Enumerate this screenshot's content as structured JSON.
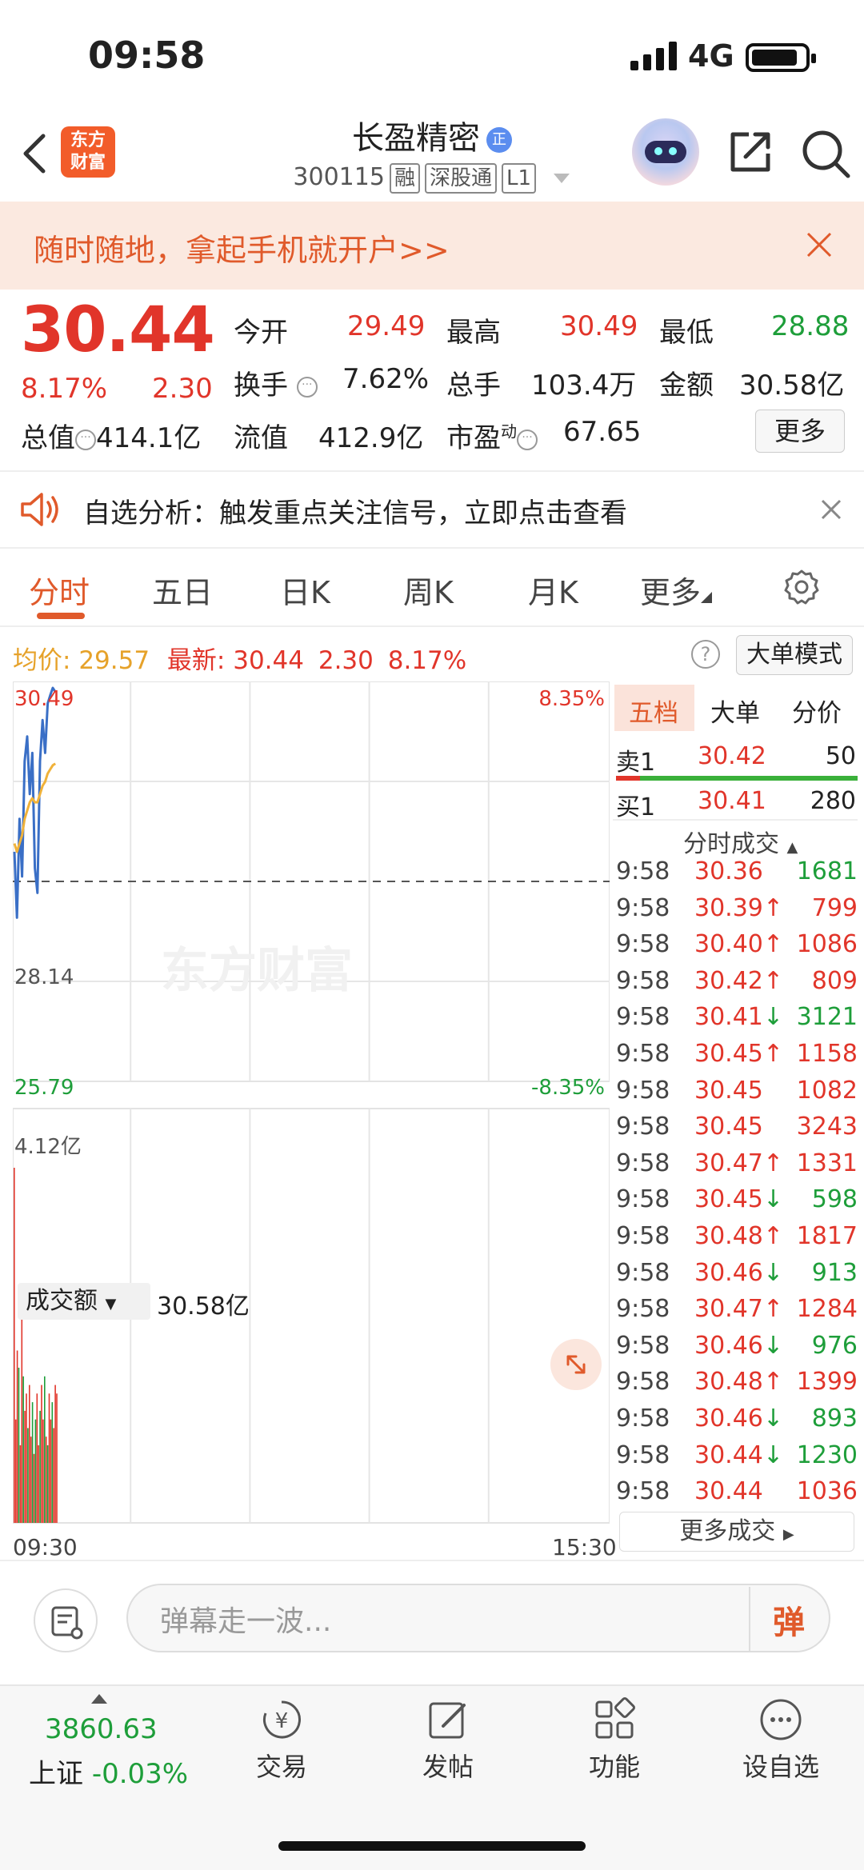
{
  "status": {
    "time": "09:58",
    "network": "4G"
  },
  "header": {
    "title": "长盈精密",
    "title_badge": "正",
    "code": "300115",
    "tags": [
      "融",
      "深股通",
      "L1"
    ],
    "logo": "东方\n财富"
  },
  "banner": {
    "text": "随时随地，拿起手机就开户>>"
  },
  "quote": {
    "price": "30.44",
    "change_pct": "8.17%",
    "change": "2.30",
    "open_label": "今开",
    "open": "29.49",
    "high_label": "最高",
    "high": "30.49",
    "low_label": "最低",
    "low": "28.88",
    "turnover_label": "换手",
    "turnover": "7.62%",
    "volume_label": "总手",
    "volume": "103.4万",
    "amount_label": "金额",
    "amount": "30.58亿",
    "mktcap_label": "总值",
    "mktcap": "414.1亿",
    "float_label": "流值",
    "float": "412.9亿",
    "pe_label": "市盈",
    "pe_sup": "动",
    "pe": "67.65",
    "more": "更多"
  },
  "notice": {
    "text": "自选分析：触发重点关注信号，立即点击查看"
  },
  "tabs": [
    "分时",
    "五日",
    "日K",
    "周K",
    "月K",
    "更多"
  ],
  "infoline": {
    "avg_label": "均价:",
    "avg": "29.57",
    "last_label": "最新:",
    "last": "30.44",
    "chg": "2.30",
    "pct": "8.17%",
    "mode": "大单模式"
  },
  "chart_labels": {
    "top_left": "30.49",
    "top_right": "8.35%",
    "mid_left": "28.14",
    "bottom_left": "25.79",
    "bottom_right": "-8.35%",
    "vol_selector": "成交额",
    "vol_value": "30.58亿",
    "vol_max": "4.12亿",
    "time_start": "09:30",
    "time_end": "15:30",
    "watermark": "东方财富"
  },
  "chart_data": {
    "type": "line",
    "ylim": [
      25.79,
      30.49
    ],
    "yclose": 28.14,
    "series": [
      {
        "name": "价格",
        "values": [
          28.5,
          27.7,
          28.9,
          28.2,
          29.6,
          29.9,
          29.2,
          29.7,
          28.3,
          28.0,
          29.6,
          30.1,
          29.7,
          30.3,
          30.4,
          30.49,
          30.44
        ]
      },
      {
        "name": "均价",
        "values": [
          28.6,
          28.5,
          28.6,
          28.7,
          28.9,
          29.0,
          29.1,
          29.15,
          29.1,
          29.1,
          29.2,
          29.3,
          29.35,
          29.45,
          29.5,
          29.55,
          29.57
        ]
      }
    ],
    "volume": [
      4.12,
      1.2,
      2.0,
      1.8,
      0.9,
      2.5,
      1.7,
      1.3,
      1.5,
      1.1,
      1.6,
      1.0,
      1.4,
      0.8,
      1.2,
      1.5,
      0.9,
      1.3,
      1.6,
      1.2,
      1.7,
      1.0,
      0.9,
      1.5,
      1.2,
      1.4,
      1.1,
      1.6,
      1.5
    ],
    "volume_colors": [
      "r",
      "r",
      "r",
      "g",
      "r",
      "r",
      "g",
      "r",
      "r",
      "g",
      "r",
      "r",
      "g",
      "r",
      "g",
      "r",
      "r",
      "g",
      "r",
      "r",
      "g",
      "r",
      "g",
      "r",
      "r",
      "g",
      "r",
      "r",
      "r"
    ]
  },
  "book": {
    "tabs": [
      "五档",
      "大单",
      "分价"
    ],
    "sell1": {
      "label": "卖1",
      "price": "30.42",
      "vol": "50"
    },
    "buy1": {
      "label": "买1",
      "price": "30.41",
      "vol": "280"
    },
    "trades_title": "分时成交",
    "trades": [
      {
        "t": "9:58",
        "p": "30.36",
        "a": "",
        "v": "1681",
        "vc": "g"
      },
      {
        "t": "9:58",
        "p": "30.39",
        "a": "↑",
        "v": "799",
        "vc": "r"
      },
      {
        "t": "9:58",
        "p": "30.40",
        "a": "↑",
        "v": "1086",
        "vc": "r"
      },
      {
        "t": "9:58",
        "p": "30.42",
        "a": "↑",
        "v": "809",
        "vc": "r"
      },
      {
        "t": "9:58",
        "p": "30.41",
        "a": "↓",
        "v": "3121",
        "vc": "g"
      },
      {
        "t": "9:58",
        "p": "30.45",
        "a": "↑",
        "v": "1158",
        "vc": "r"
      },
      {
        "t": "9:58",
        "p": "30.45",
        "a": "",
        "v": "1082",
        "vc": "r"
      },
      {
        "t": "9:58",
        "p": "30.45",
        "a": "",
        "v": "3243",
        "vc": "r"
      },
      {
        "t": "9:58",
        "p": "30.47",
        "a": "↑",
        "v": "1331",
        "vc": "r"
      },
      {
        "t": "9:58",
        "p": "30.45",
        "a": "↓",
        "v": "598",
        "vc": "g"
      },
      {
        "t": "9:58",
        "p": "30.48",
        "a": "↑",
        "v": "1817",
        "vc": "r"
      },
      {
        "t": "9:58",
        "p": "30.46",
        "a": "↓",
        "v": "913",
        "vc": "g"
      },
      {
        "t": "9:58",
        "p": "30.47",
        "a": "↑",
        "v": "1284",
        "vc": "r"
      },
      {
        "t": "9:58",
        "p": "30.46",
        "a": "↓",
        "v": "976",
        "vc": "g"
      },
      {
        "t": "9:58",
        "p": "30.48",
        "a": "↑",
        "v": "1399",
        "vc": "r"
      },
      {
        "t": "9:58",
        "p": "30.46",
        "a": "↓",
        "v": "893",
        "vc": "g"
      },
      {
        "t": "9:58",
        "p": "30.44",
        "a": "↓",
        "v": "1230",
        "vc": "g"
      },
      {
        "t": "9:58",
        "p": "30.44",
        "a": "",
        "v": "1036",
        "vc": "r"
      }
    ],
    "more": "更多成交"
  },
  "danmu": {
    "placeholder": "弹幕走一波...",
    "button": "弹"
  },
  "nav": {
    "index_value": "3860.63",
    "index_name": "上证",
    "index_pct": "-0.03%",
    "items": [
      "交易",
      "发帖",
      "功能",
      "设自选"
    ]
  },
  "colors": {
    "red": "#e1352a",
    "green": "#1e9e3a",
    "accent": "#e05a2b",
    "price_line": "#3a6fc6",
    "avg_line": "#f0b23a"
  }
}
